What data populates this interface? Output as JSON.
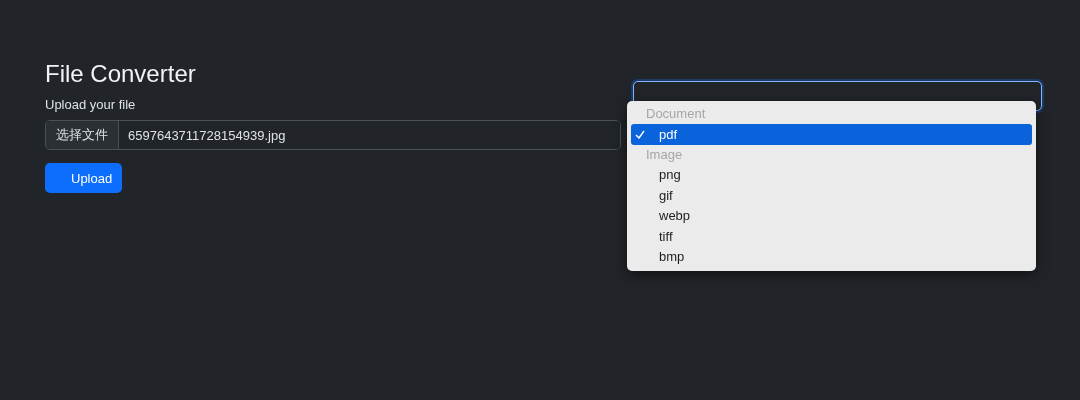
{
  "title": "File Converter",
  "file_field": {
    "label": "Upload your file",
    "button_label": "选择文件",
    "file_name": "6597643711728154939.jpg"
  },
  "upload_button": "Upload",
  "format_menu": {
    "groups": [
      {
        "label": "Document",
        "options": [
          {
            "label": "pdf",
            "selected": true
          }
        ]
      },
      {
        "label": "Image",
        "options": [
          {
            "label": "png",
            "selected": false
          },
          {
            "label": "gif",
            "selected": false
          },
          {
            "label": "webp",
            "selected": false
          },
          {
            "label": "tiff",
            "selected": false
          },
          {
            "label": "bmp",
            "selected": false
          }
        ]
      }
    ]
  }
}
